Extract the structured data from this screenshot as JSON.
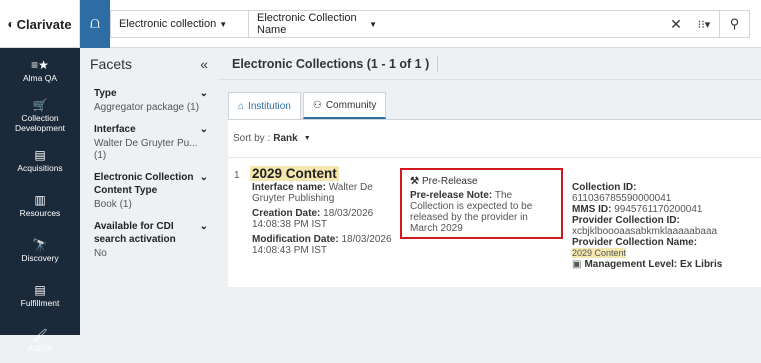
{
  "brand": {
    "name": "Clarivate",
    "logo_icon": "clarivate-logo"
  },
  "search": {
    "scope_icon": "scope-icon",
    "type": "Electronic collection",
    "field": "Electronic Collection Name",
    "clear_icon": "close-icon",
    "advanced_icon": "advanced-search-icon",
    "search_icon": "search-icon"
  },
  "nav": [
    {
      "label": "Alma QA",
      "icon": "menu-star-icon",
      "glyph": "≡★"
    },
    {
      "label": "Collection Development",
      "icon": "collection-icon",
      "glyph": "🛒"
    },
    {
      "label": "Acquisitions",
      "icon": "acquisitions-icon",
      "glyph": "▤"
    },
    {
      "label": "Resources",
      "icon": "resources-icon",
      "glyph": "▥"
    },
    {
      "label": "Discovery",
      "icon": "discovery-icon",
      "glyph": "🔭"
    },
    {
      "label": "Fulfillment",
      "icon": "fulfillment-icon",
      "glyph": "▤"
    },
    {
      "label": "Admin",
      "icon": "admin-icon",
      "glyph": "🖌"
    }
  ],
  "facets": {
    "title": "Facets",
    "collapse_icon": "«",
    "groups": [
      {
        "title": "Type",
        "value": "Aggregator package (1)"
      },
      {
        "title": "Interface",
        "value": "Walter De Gruyter Pu... (1)"
      },
      {
        "title": "Electronic Collection Content Type",
        "value": "Book (1)"
      },
      {
        "title": "Available for CDI search activation",
        "value": "No"
      }
    ]
  },
  "main": {
    "title": "Electronic Collections (1 - 1 of 1 )",
    "tabs": [
      {
        "label": "Institution",
        "icon": "home-icon"
      },
      {
        "label": "Community",
        "icon": "community-icon"
      }
    ],
    "sort_label": "Sort by :",
    "sort_value": "Rank"
  },
  "result": {
    "number": "1",
    "title": "2029 Content",
    "interface_label": "Interface name:",
    "interface_value": "Walter De Gruyter Publishing",
    "creation_label": "Creation Date:",
    "creation_value": "18/03/2026 14:08:38 PM IST",
    "modification_label": "Modification Date:",
    "modification_value": "18/03/2026 14:08:43 PM IST",
    "prerelease_title": "Pre-Release",
    "prerelease_note_label": "Pre-release Note:",
    "prerelease_note_value": "The Collection is expected to be released by the provider in March 2029",
    "collection_id_label": "Collection ID:",
    "collection_id_value": "611036785590000041",
    "mms_label": "MMS ID:",
    "mms_value": "9945761170200041",
    "provider_id_label": "Provider Collection ID:",
    "provider_id_value": "xcbjklboooaasabkmklaaaaabaaa",
    "provider_name_label": "Provider Collection Name:",
    "provider_name_value": "2029 Content",
    "mgmt_label": "Management Level:",
    "mgmt_value": "Ex Libris",
    "highlight_color": "#f4e7b0",
    "border_color": "#d0191f"
  }
}
